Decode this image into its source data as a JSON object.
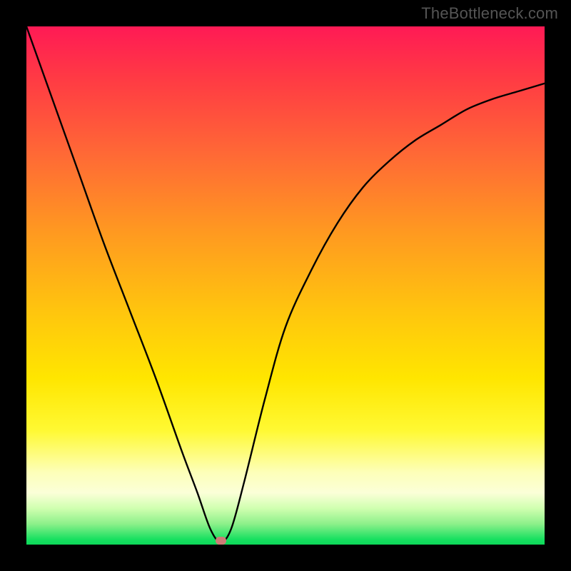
{
  "watermark": "TheBottleneck.com",
  "marker": {
    "x_frac": 0.375,
    "y_frac": 0.993
  },
  "chart_data": {
    "type": "line",
    "title": "",
    "xlabel": "",
    "ylabel": "",
    "xlim": [
      0,
      1
    ],
    "ylim": [
      0,
      1
    ],
    "series": [
      {
        "name": "bottleneck-curve",
        "x": [
          0.0,
          0.05,
          0.1,
          0.15,
          0.2,
          0.25,
          0.3,
          0.33,
          0.355,
          0.375,
          0.395,
          0.42,
          0.46,
          0.5,
          0.55,
          0.6,
          0.65,
          0.7,
          0.75,
          0.8,
          0.85,
          0.9,
          0.95,
          1.0
        ],
        "y": [
          1.0,
          0.86,
          0.72,
          0.58,
          0.45,
          0.32,
          0.18,
          0.1,
          0.03,
          0.005,
          0.03,
          0.12,
          0.28,
          0.42,
          0.53,
          0.62,
          0.69,
          0.74,
          0.78,
          0.81,
          0.84,
          0.86,
          0.875,
          0.89
        ]
      }
    ],
    "marker": {
      "x": 0.375,
      "y": 0.005
    },
    "colors": {
      "curve": "#000000",
      "marker": "#cd7b76",
      "gradient_top": "#ff1a55",
      "gradient_bottom": "#0dd95a"
    }
  }
}
